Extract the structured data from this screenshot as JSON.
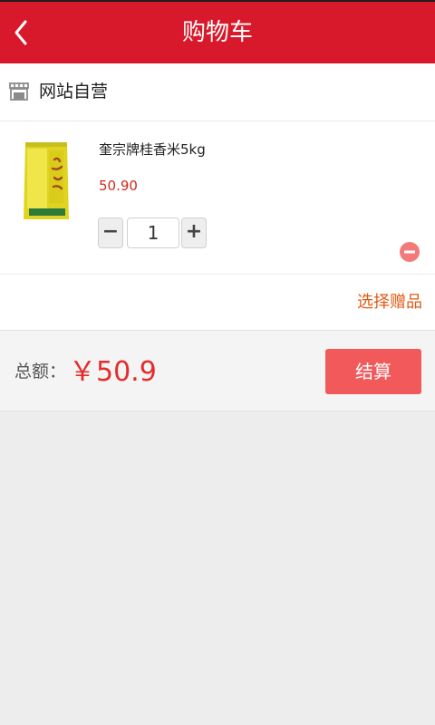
{
  "header": {
    "title": "购物车",
    "back_icon": "chevron-left-icon"
  },
  "store": {
    "name": "网站自营",
    "icon": "store-icon"
  },
  "cart_item": {
    "name": "奎宗牌桂香米5kg",
    "price": "50.90",
    "quantity": "1",
    "minus_label": "−",
    "plus_label": "+",
    "remove_icon": "remove-circle-icon"
  },
  "gift": {
    "label": "选择赠品"
  },
  "footer": {
    "total_label": "总额：",
    "total_amount": "￥50.9",
    "checkout_label": "结算"
  },
  "colors": {
    "header_bg": "#d8192b",
    "price": "#d02a1c",
    "total": "#e62b2b",
    "checkout_bg": "#f2595a",
    "gift_link": "#e25a14",
    "remove": "#f37a78"
  }
}
